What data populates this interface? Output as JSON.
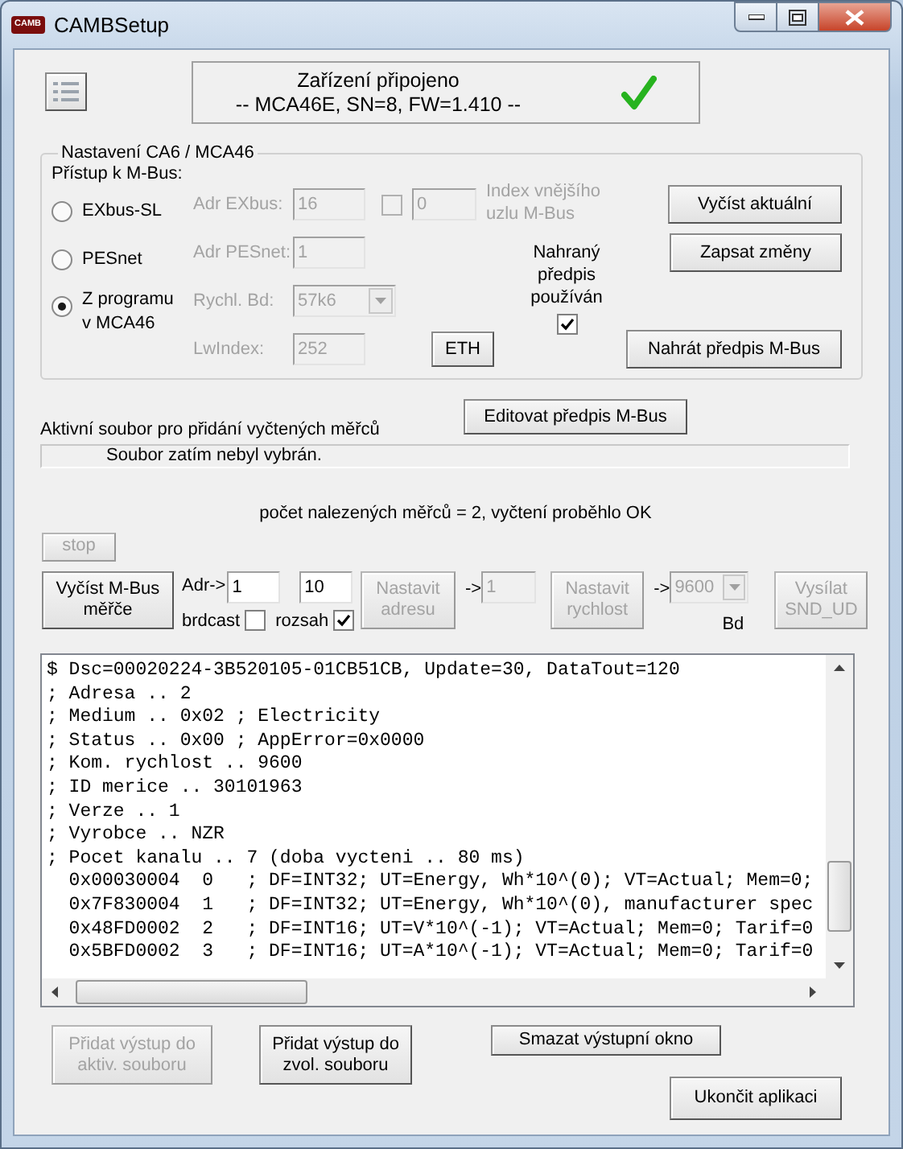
{
  "window": {
    "title": "CAMBSetup",
    "logo": "CAMB"
  },
  "connection": {
    "title": "Zařízení připojeno",
    "device": "-- MCA46E, SN=8, FW=1.410 --",
    "connected": true
  },
  "settings": {
    "title": "Nastavení CA6 / MCA46",
    "access_label": "Přístup k M-Bus:",
    "access_options": [
      {
        "label": "EXbus-SL",
        "selected": false
      },
      {
        "label": "PESnet",
        "selected": false
      },
      {
        "label": "Z programu v MCA46",
        "selected": true
      }
    ],
    "adr_exbus": {
      "label": "Adr EXbus:",
      "value": "16",
      "disabled": true
    },
    "node_index": {
      "checked": false,
      "disabled": true,
      "value": "0",
      "label": "Index vnějšího uzlu M-Bus"
    },
    "adr_pesnet": {
      "label": "Adr PESnet:",
      "value": "1",
      "disabled": true
    },
    "baud": {
      "label": "Rychl. Bd:",
      "value": "57k6",
      "disabled": true
    },
    "lwindex": {
      "label": "LwIndex:",
      "value": "252",
      "disabled": true
    },
    "eth_button": {
      "label": "ETH",
      "disabled": false
    },
    "uploaded_used": {
      "label": "Nahraný předpis používán",
      "checked": true
    },
    "buttons": [
      {
        "label": "Vyčíst aktuální",
        "disabled": false
      },
      {
        "label": "Zapsat změny",
        "disabled": false
      },
      {
        "label": "Nahrát předpis M-Bus",
        "disabled": false
      }
    ]
  },
  "edit_button": {
    "label": "Editovat předpis M-Bus",
    "disabled": false
  },
  "active_file": {
    "label": "Aktivní soubor pro přidání vyčtených měřců",
    "value": "Soubor zatím nebyl vybrán."
  },
  "scan_result": "počet nalezených měřců = 2, vyčtení proběhlo OK",
  "stop_button": {
    "label": "stop",
    "disabled": true
  },
  "scan": {
    "read_button": {
      "label": "Vyčíst M-Bus měřče",
      "disabled": false
    },
    "addr_label": "Adr->",
    "addr_from": "1",
    "addr_to": "10",
    "broadcast": {
      "label": "brdcast",
      "checked": false
    },
    "range": {
      "label": "rozsah",
      "checked": true
    },
    "set_address": {
      "label": "Nastavit adresu",
      "disabled": true
    },
    "arrow_address": "->",
    "new_address": {
      "value": "1",
      "disabled": true
    },
    "set_speed": {
      "label": "Nastavit rychlost",
      "disabled": true
    },
    "arrow_speed": "->",
    "new_speed": {
      "value": "9600",
      "disabled": true
    },
    "speed_unit": "Bd",
    "send_button": {
      "label": "Vysílat SND_UD",
      "disabled": true
    }
  },
  "output": {
    "lines": [
      "$ Dsc=00020224-3B520105-01CB51CB, Update=30, DataTout=120",
      "; Adresa .. 2",
      "; Medium .. 0x02 ; Electricity",
      "; Status .. 0x00 ; AppError=0x0000",
      "; Kom. rychlost .. 9600",
      "; ID merice .. 30101963",
      "; Verze .. 1",
      "; Vyrobce .. NZR",
      "; Pocet kanalu .. 7 (doba vycteni .. 80 ms)",
      "  0x00030004  0   ; DF=INT32; UT=Energy, Wh*10^(0); VT=Actual; Mem=0;",
      "  0x7F830004  1   ; DF=INT32; UT=Energy, Wh*10^(0), manufacturer spec",
      "  0x48FD0002  2   ; DF=INT16; UT=V*10^(-1); VT=Actual; Mem=0; Tarif=0",
      "  0x5BFD0002  3   ; DF=INT16; UT=A*10^(-1); VT=Actual; Mem=0; Tarif=0"
    ]
  },
  "bottom_buttons": [
    {
      "label": "Přidat výstup do aktiv. souboru",
      "disabled": true
    },
    {
      "label": "Přidat výstup do zvol. souboru",
      "disabled": false
    }
  ],
  "clear_button": {
    "label": "Smazat výstupní okno",
    "disabled": false
  },
  "exit_button": {
    "label": "Ukončit aplikaci",
    "disabled": false
  }
}
